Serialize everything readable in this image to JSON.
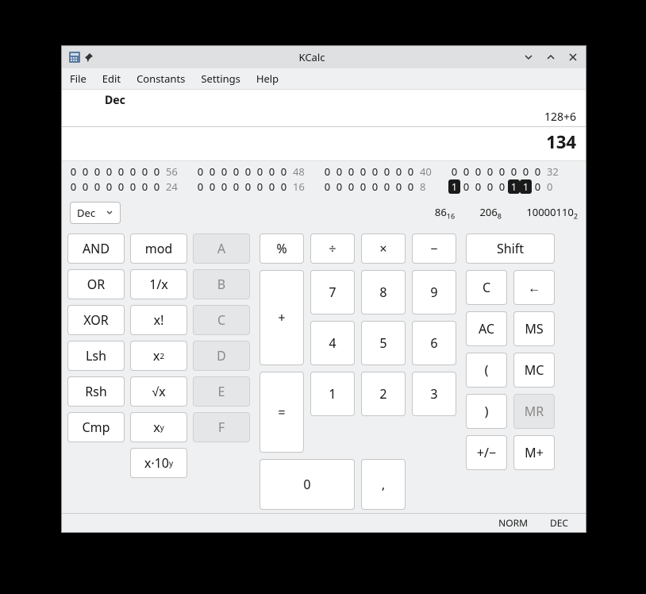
{
  "window": {
    "title": "KCalc"
  },
  "menu": {
    "file": "File",
    "edit": "Edit",
    "constants": "Constants",
    "settings": "Settings",
    "help": "Help"
  },
  "display": {
    "mode": "Dec",
    "input": "128+6",
    "result": "134"
  },
  "bits": {
    "row1": [
      {
        "bits": [
          0,
          0,
          0,
          0,
          0,
          0,
          0,
          0
        ],
        "index": "56"
      },
      {
        "bits": [
          0,
          0,
          0,
          0,
          0,
          0,
          0,
          0
        ],
        "index": "48"
      },
      {
        "bits": [
          0,
          0,
          0,
          0,
          0,
          0,
          0,
          0
        ],
        "index": "40"
      },
      {
        "bits": [
          0,
          0,
          0,
          0,
          0,
          0,
          0,
          0
        ],
        "index": "32"
      }
    ],
    "row2": [
      {
        "bits": [
          0,
          0,
          0,
          0,
          0,
          0,
          0,
          0
        ],
        "index": "24"
      },
      {
        "bits": [
          0,
          0,
          0,
          0,
          0,
          0,
          0,
          0
        ],
        "index": "16"
      },
      {
        "bits": [
          0,
          0,
          0,
          0,
          0,
          0,
          0,
          0
        ],
        "index": "8"
      },
      {
        "bits": [
          1,
          0,
          0,
          0,
          0,
          1,
          1,
          0
        ],
        "index": "0"
      }
    ]
  },
  "dropdown": {
    "value": "Dec"
  },
  "bases": {
    "hex_v": "86",
    "hex_s": "16",
    "oct_v": "206",
    "oct_s": "8",
    "bin_v": "10000110",
    "bin_s": "2"
  },
  "logic": {
    "and": "AND",
    "mod": "mod",
    "a": "A",
    "or": "OR",
    "inv": "1/x",
    "b": "B",
    "xor": "XOR",
    "fact": "x!",
    "c": "C",
    "lsh": "Lsh",
    "sq_base": "x",
    "sq_exp": "2",
    "d": "D",
    "rsh": "Rsh",
    "sqrt": "√x",
    "e": "E",
    "cmp": "Cmp",
    "xy_base": "x",
    "xy_exp": "y",
    "f": "F",
    "x10_base": "x·10",
    "x10_exp": "y"
  },
  "num": {
    "pct": "%",
    "div": "÷",
    "mul": "×",
    "sub": "−",
    "7": "7",
    "8": "8",
    "9": "9",
    "4": "4",
    "5": "5",
    "6": "6",
    "add": "+",
    "1": "1",
    "2": "2",
    "3": "3",
    "0": "0",
    "comma": ",",
    "eq": "="
  },
  "right": {
    "shift": "Shift",
    "c": "C",
    "back": "←",
    "ac": "AC",
    "ms": "MS",
    "lp": "(",
    "mc": "MC",
    "rp": ")",
    "mr": "MR",
    "pm": "+/−",
    "mp": "M+"
  },
  "status": {
    "norm": "NORM",
    "dec": "DEC"
  }
}
